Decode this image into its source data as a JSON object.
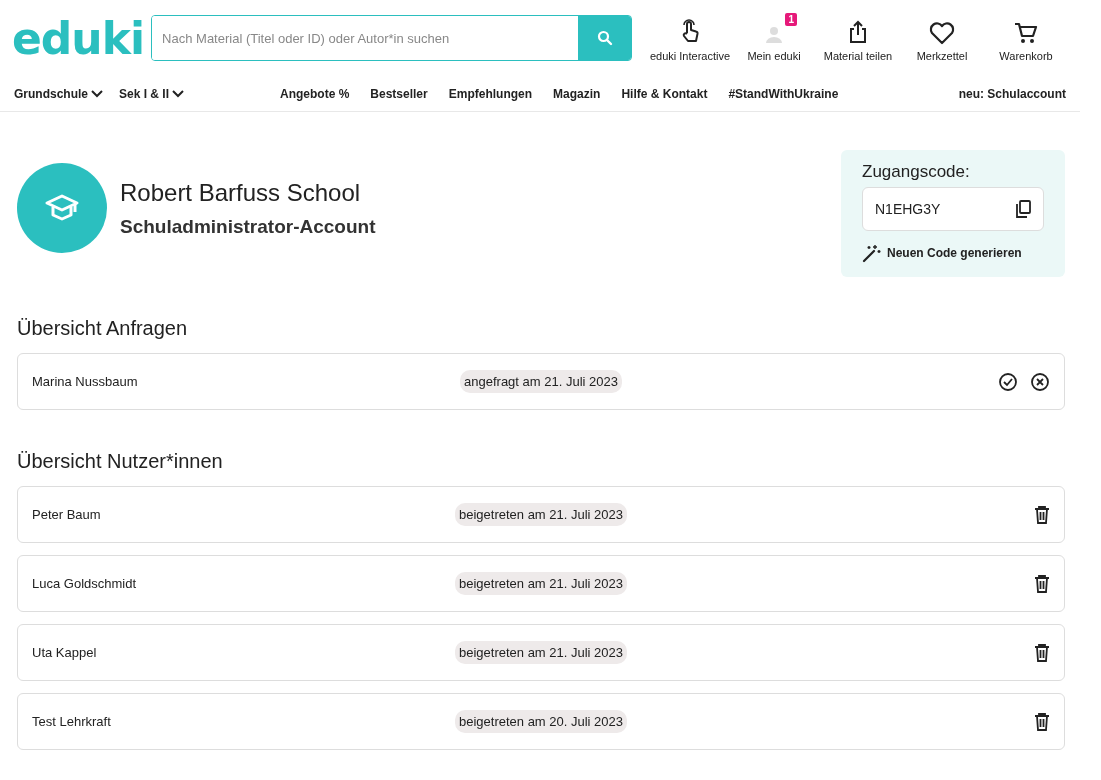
{
  "header": {
    "logo": "eduki",
    "search": {
      "placeholder": "Nach Material (Titel oder ID) oder Autor*in suchen"
    },
    "actions": [
      {
        "kind": "hand",
        "label": "eduki Interactive"
      },
      {
        "kind": "user",
        "label": "Mein eduki",
        "badge": "1"
      },
      {
        "kind": "share",
        "label": "Material teilen"
      },
      {
        "kind": "heart",
        "label": "Merkzettel"
      },
      {
        "kind": "cart",
        "label": "Warenkorb"
      }
    ]
  },
  "nav": {
    "left": [
      {
        "label": "Grundschule",
        "dropdown": true
      },
      {
        "label": "Sek I & II",
        "dropdown": true
      }
    ],
    "center": [
      {
        "label": "Angebote %"
      },
      {
        "label": "Bestseller"
      },
      {
        "label": "Empfehlungen"
      },
      {
        "label": "Magazin"
      },
      {
        "label": "Hilfe & Kontakt"
      },
      {
        "label": "#StandWithUkraine"
      }
    ],
    "right": "neu: Schulaccount"
  },
  "school": {
    "name": "Robert Barfuss School",
    "role": "Schuladministrator-Account"
  },
  "access": {
    "title": "Zugangscode:",
    "code": "N1EHG3Y",
    "generate": "Neuen Code generieren"
  },
  "requests": {
    "title": "Übersicht Anfragen",
    "rows": [
      {
        "name": "Marina Nussbaum",
        "date": "angefragt am 21. Juli 2023",
        "kind": "request"
      }
    ]
  },
  "users": {
    "title": "Übersicht Nutzer*innen",
    "rows": [
      {
        "name": "Peter Baum",
        "date": "beigetreten am 21. Juli 2023",
        "kind": "member"
      },
      {
        "name": "Luca Goldschmidt",
        "date": "beigetreten am 21. Juli 2023",
        "kind": "member"
      },
      {
        "name": "Uta Kappel",
        "date": "beigetreten am 21. Juli 2023",
        "kind": "member"
      },
      {
        "name": "Test Lehrkraft",
        "date": "beigetreten am 20. Juli 2023",
        "kind": "member"
      }
    ]
  }
}
